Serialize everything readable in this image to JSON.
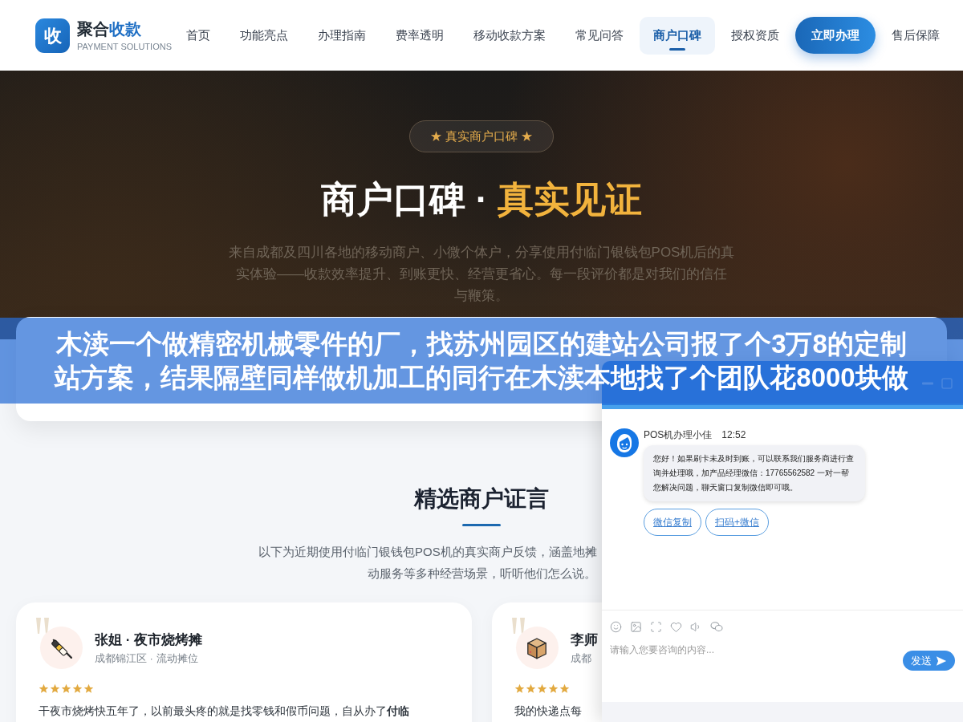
{
  "header": {
    "logo_mark": "收",
    "brand": "聚合",
    "brand_highlight": "收款",
    "tagline": "PAYMENT SOLUTIONS",
    "nav": [
      {
        "label": "首页",
        "kind": "link",
        "selected": false
      },
      {
        "label": "功能亮点",
        "kind": "link",
        "selected": false
      },
      {
        "label": "办理指南",
        "kind": "link",
        "selected": false
      },
      {
        "label": "费率透明",
        "kind": "link",
        "selected": false
      },
      {
        "label": "移动收款方案",
        "kind": "link",
        "selected": false
      },
      {
        "label": "常见问答",
        "kind": "link",
        "selected": false
      },
      {
        "label": "商户口碑",
        "kind": "link",
        "selected": true
      },
      {
        "label": "授权资质",
        "kind": "link",
        "selected": false
      },
      {
        "label": "立即办理",
        "kind": "cta",
        "selected": false
      },
      {
        "label": "售后保障",
        "kind": "link",
        "selected": false
      }
    ]
  },
  "hero": {
    "badge": "★ 真实商户口碑 ★",
    "title": "商户口碑 ·",
    "title_highlight": "真实见证",
    "description_lines": [
      "来自成都及四川各地的移动商户、小微个体户，分享使用付临门银钱包POS机后的真",
      "实体验——收款效率提升、到账更快、经营更省心。每一段评价都是对我们的信任",
      "与鞭策。"
    ]
  },
  "banner": {
    "lines": [
      "木渎一个做精密机械零件的厂，找苏州园区的建站公司报了个3万8的定制",
      "站方案，结果隔壁同样做机加工的同行在木渎本地找了个团队花8000块做"
    ]
  },
  "testimonials": {
    "title": "精选商户证言",
    "subtitle_lines": [
      "以下为近期使用付临门银钱包POS机的真实商户反馈，涵盖地摊",
      "动服务等多种经营场景，听听他们怎么说。"
    ],
    "cards": [
      {
        "name": "张姐 · 夜市烧烤摊",
        "location": "成都锦江区 · 流动摊位",
        "stars": 5,
        "text": "干夜市烧烤快五年了，以前最头疼的就是找零钱和假币问题，自从办了**付临**"
      },
      {
        "name": "李师",
        "location": "成都",
        "stars": 5,
        "text": "我的快递点每"
      }
    ]
  },
  "chat": {
    "agent": "POS机办理小佳",
    "time": "12:52",
    "message": "您好！如果刷卡未及时到账，可以联系我们服务商进行查询并处理哦，加产品经理微信：17765562582 一对一帮您解决问题，聊天窗口复制微信即可哦。",
    "actions": [
      "微信复制",
      "扫码+微信"
    ],
    "input": {
      "placeholder": "请输入您要咨询的内容..."
    },
    "send": "发送"
  }
}
